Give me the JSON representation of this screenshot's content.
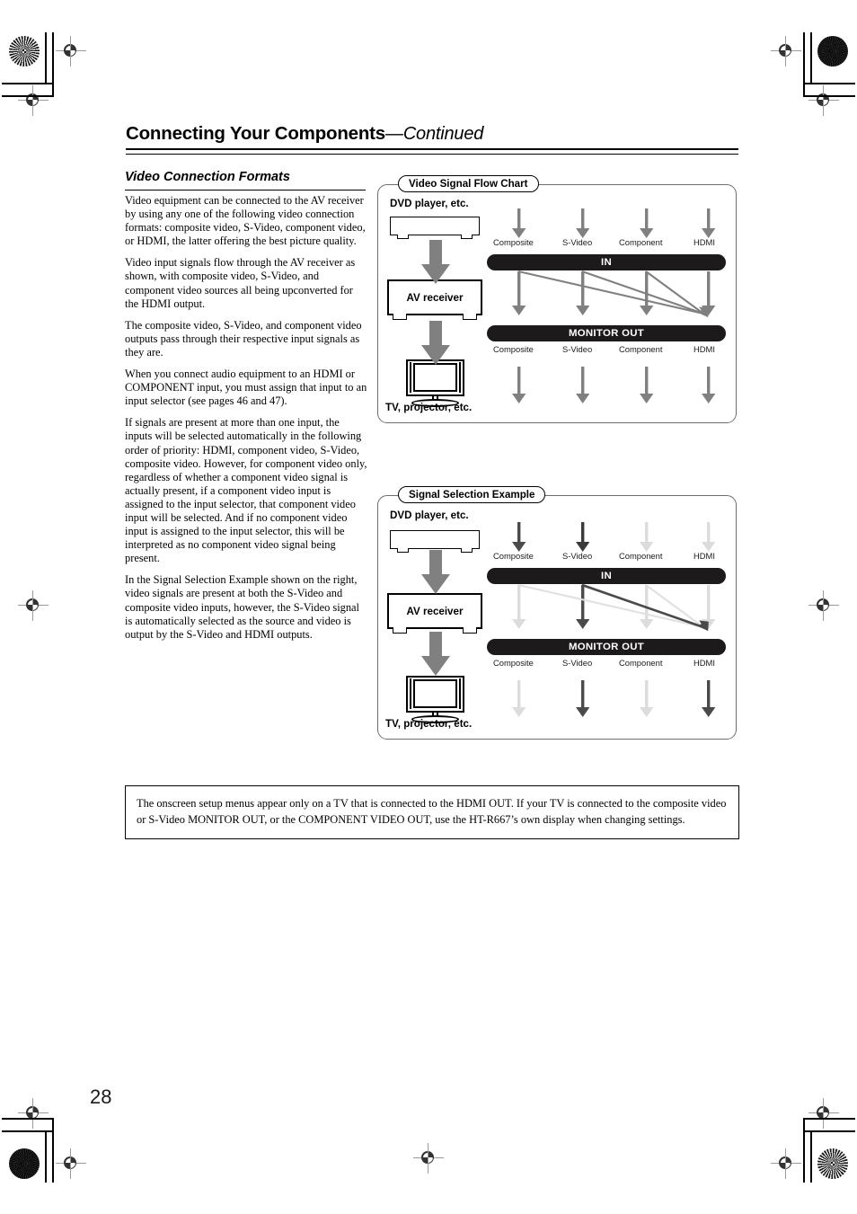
{
  "header": {
    "title": "Connecting Your Components",
    "continued": "—Continued"
  },
  "section": {
    "title": "Video Connection Formats",
    "paragraphs": [
      "Video equipment can be connected to the AV receiver by using any one of the following video connection formats: composite video, S-Video, component video, or HDMI, the latter offering the best picture quality.",
      "Video input signals flow through the AV receiver as shown, with composite video, S-Video, and component video sources all being upconverted for the HDMI output.",
      "The composite video, S-Video, and component video outputs pass through their respective input signals as they are.",
      "When you connect audio equipment to an HDMI or COMPONENT input, you must assign that input to an input selector (see pages 46 and 47).",
      "If signals are present at more than one input, the inputs will be selected automatically in the following order of priority: HDMI, component video, S-Video, composite video. However, for component video only, regardless of whether a component video signal is actually present, if a component video input is assigned to the input selector, that component video input will be selected. And if no component video input is assigned to the input selector, this will be interpreted as no component video signal being present.",
      "In the Signal Selection Example shown on the right, video signals are present at both the S-Video and composite video inputs, however, the S-Video signal is automatically selected as the source and video is output by the S-Video and HDMI outputs."
    ]
  },
  "diagram1": {
    "legend": "Video Signal Flow Chart",
    "source_label": "DVD player, etc.",
    "receiver_label": "AV receiver",
    "display_label": "TV, projector, etc.",
    "in_bar": "IN",
    "out_bar": "MONITOR OUT",
    "in_ports": [
      "Composite",
      "S-Video",
      "Component",
      "HDMI"
    ],
    "out_ports": [
      "Composite",
      "S-Video",
      "Component",
      "HDMI"
    ]
  },
  "diagram2": {
    "legend": "Signal Selection Example",
    "source_label": "DVD player, etc.",
    "receiver_label": "AV receiver",
    "display_label": "TV, projector, etc.",
    "in_bar": "IN",
    "out_bar": "MONITOR OUT",
    "in_ports": [
      "Composite",
      "S-Video",
      "Component",
      "HDMI"
    ],
    "out_ports": [
      "Composite",
      "S-Video",
      "Component",
      "HDMI"
    ]
  },
  "note": {
    "text": "The onscreen setup menus appear only on a TV that is connected to the HDMI OUT. If your TV is connected to the composite video or S-Video MONITOR OUT, or the COMPONENT VIDEO OUT, use the HT-R667’s own display when changing settings."
  },
  "footer": {
    "page_number": "28"
  },
  "colors": {
    "arrow_active": "#7d7d7d",
    "arrow_strong": "#4a4a4a",
    "arrow_faded": "#dcdcdc",
    "bar_fill": "#1c1a1a",
    "panel_border": "#6d6d6d"
  }
}
